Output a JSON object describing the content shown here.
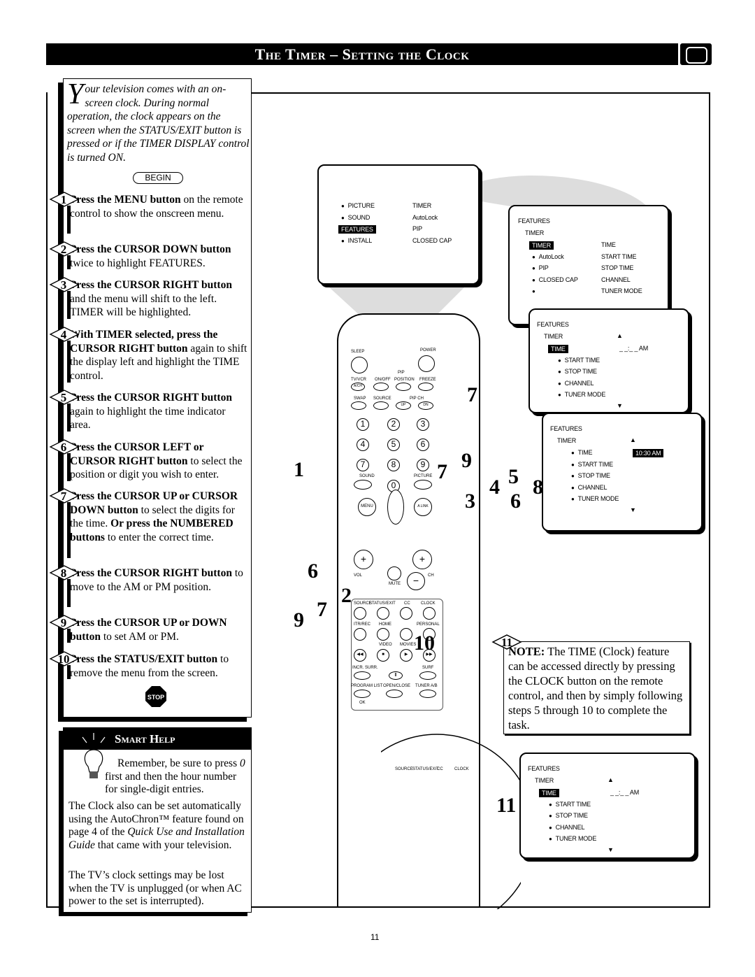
{
  "header": {
    "title": "The Timer – Setting the Clock",
    "icon": "tv-icon"
  },
  "intro": {
    "dropcap": "Y",
    "text": "our television comes with an on-screen clock.  During normal operation, the clock appears on the screen when the STATUS/EXIT button is pressed or if the TIMER DISPLAY control is turned ON."
  },
  "begin_label": "BEGIN",
  "steps": [
    {
      "n": "1",
      "bold": "Press the MENU button",
      "rest": " on the remote control to show the onscreen menu."
    },
    {
      "n": "2",
      "bold": "Press the CURSOR DOWN button",
      "rest": " twice to highlight FEATURES."
    },
    {
      "n": "3",
      "bold": "Press the CURSOR RIGHT button",
      "rest": " and the menu will shift to the left. TIMER will be highlighted."
    },
    {
      "n": "4",
      "bold": "With TIMER selected, press the CURSOR RIGHT button",
      "rest": " again to shift the display left and highlight the TIME control."
    },
    {
      "n": "5",
      "bold": "Press the CURSOR RIGHT button",
      "rest": " again to highlight the time indicator area."
    },
    {
      "n": "6",
      "bold": "Press the CURSOR LEFT or CURSOR RIGHT button",
      "rest": " to select the position or digit you wish to enter."
    },
    {
      "n": "7",
      "bold": "Press the CURSOR UP or CURSOR DOWN button",
      "rest": " to select the digits for the time. ",
      "bold2": "Or press the NUMBERED buttons",
      "rest2": " to enter the correct time."
    },
    {
      "n": "8",
      "bold": "Press the CURSOR RIGHT button",
      "rest": " to move to the AM or PM position."
    },
    {
      "n": "9",
      "bold": "Press the CURSOR UP or DOWN button",
      "rest": " to set AM or PM."
    },
    {
      "n": "10",
      "bold": "Press the STATUS/EXIT button",
      "rest": " to remove the menu from the screen."
    }
  ],
  "stop_label": "STOP",
  "smart_help": {
    "title": "Smart Help",
    "p1_pre": "Remember, be sure to press ",
    "p1_em": "0",
    "p1_post": " first and then the hour number for single-digit entries.",
    "p2_pre": "The Clock also can be set automatically using the AutoChron™ feature found on page 4 of the ",
    "p2_em": "Quick Use and Installation Guide",
    "p2_post": " that came with your television.",
    "p3": "The TV’s clock settings may be lost when the TV is unplugged (or when AC power to the set is interrupted)."
  },
  "screens": {
    "s1": {
      "left": [
        "PICTURE",
        "SOUND",
        "FEATURES",
        "INSTALL"
      ],
      "right": [
        "TIMER",
        "AutoLock",
        "PIP",
        "CLOSED  CAP"
      ]
    },
    "s2": {
      "h1": "FEATURES",
      "h2": "TIMER",
      "left": [
        "TIMER",
        "AutoLock",
        "PIP",
        "CLOSED  CAP"
      ],
      "right": [
        "TIME",
        "START  TIME",
        "STOP  TIME",
        "CHANNEL",
        "TUNER  MODE"
      ]
    },
    "s3": {
      "h1": "FEATURES",
      "h2": "TIMER",
      "items": [
        "TIME",
        "START  TIME",
        "STOP  TIME",
        "CHANNEL",
        "TUNER  MODE"
      ],
      "value": "_ _:_ _  AM"
    },
    "s4": {
      "h1": "FEATURES",
      "h2": "TIMER",
      "items": [
        "TIME",
        "START  TIME",
        "STOP  TIME",
        "CHANNEL",
        "TUNER  MODE"
      ],
      "value": "10:30  AM"
    },
    "s5": {
      "h1": "FEATURES",
      "h2": "TIMER",
      "items": [
        "TIME",
        "START  TIME",
        "STOP  TIME",
        "CHANNEL",
        "TUNER  MODE"
      ],
      "value": "_ _:_ _  AM"
    }
  },
  "remote": {
    "labels": {
      "sleep": "SLEEP",
      "power": "POWER",
      "pip": "PIP",
      "tvvcr": "TV/VCR",
      "onoff": "ON/OFF",
      "position": "POSITION",
      "freeze": "FREEZE",
      "ach": "A/CH",
      "swap": "SWAP",
      "source": "SOURCE",
      "pipch": "PIP CH",
      "up": "UP",
      "dn": "DN",
      "sound": "SOUND",
      "picture": "PICTURE",
      "menu": "MENU",
      "alink": "A LINK",
      "vol": "VOL",
      "ch": "CH",
      "mute": "MUTE",
      "source2": "SOURCE",
      "status": "STATUS/EXIT",
      "cc": "CC",
      "clock": "CLOCK",
      "itrrec": "ITR/REC",
      "home": "HOME",
      "personal": "PERSONAL",
      "video": "VIDEO",
      "movies": "MOVIES",
      "incr": "INCR. SURR.",
      "surf": "SURF",
      "proglist": "PROGRAM LIST",
      "openclose": "OPEN/CLOSE",
      "tuner": "TUNER A/B",
      "ok": "OK"
    },
    "digits": [
      "1",
      "2",
      "3",
      "4",
      "5",
      "6",
      "7",
      "8",
      "9",
      "0"
    ]
  },
  "callouts": [
    "1",
    "7",
    "9",
    "7",
    "5",
    "4",
    "8",
    "3",
    "6",
    "6",
    "2",
    "7",
    "9",
    "10",
    "11"
  ],
  "note": {
    "n": "11",
    "bold": "NOTE:",
    "text": "  The TIME (Clock) feature can be accessed directly by pressing the CLOCK button on the remote control, and then by simply following steps 5 through 10 to complete the task."
  },
  "page_number": "11"
}
